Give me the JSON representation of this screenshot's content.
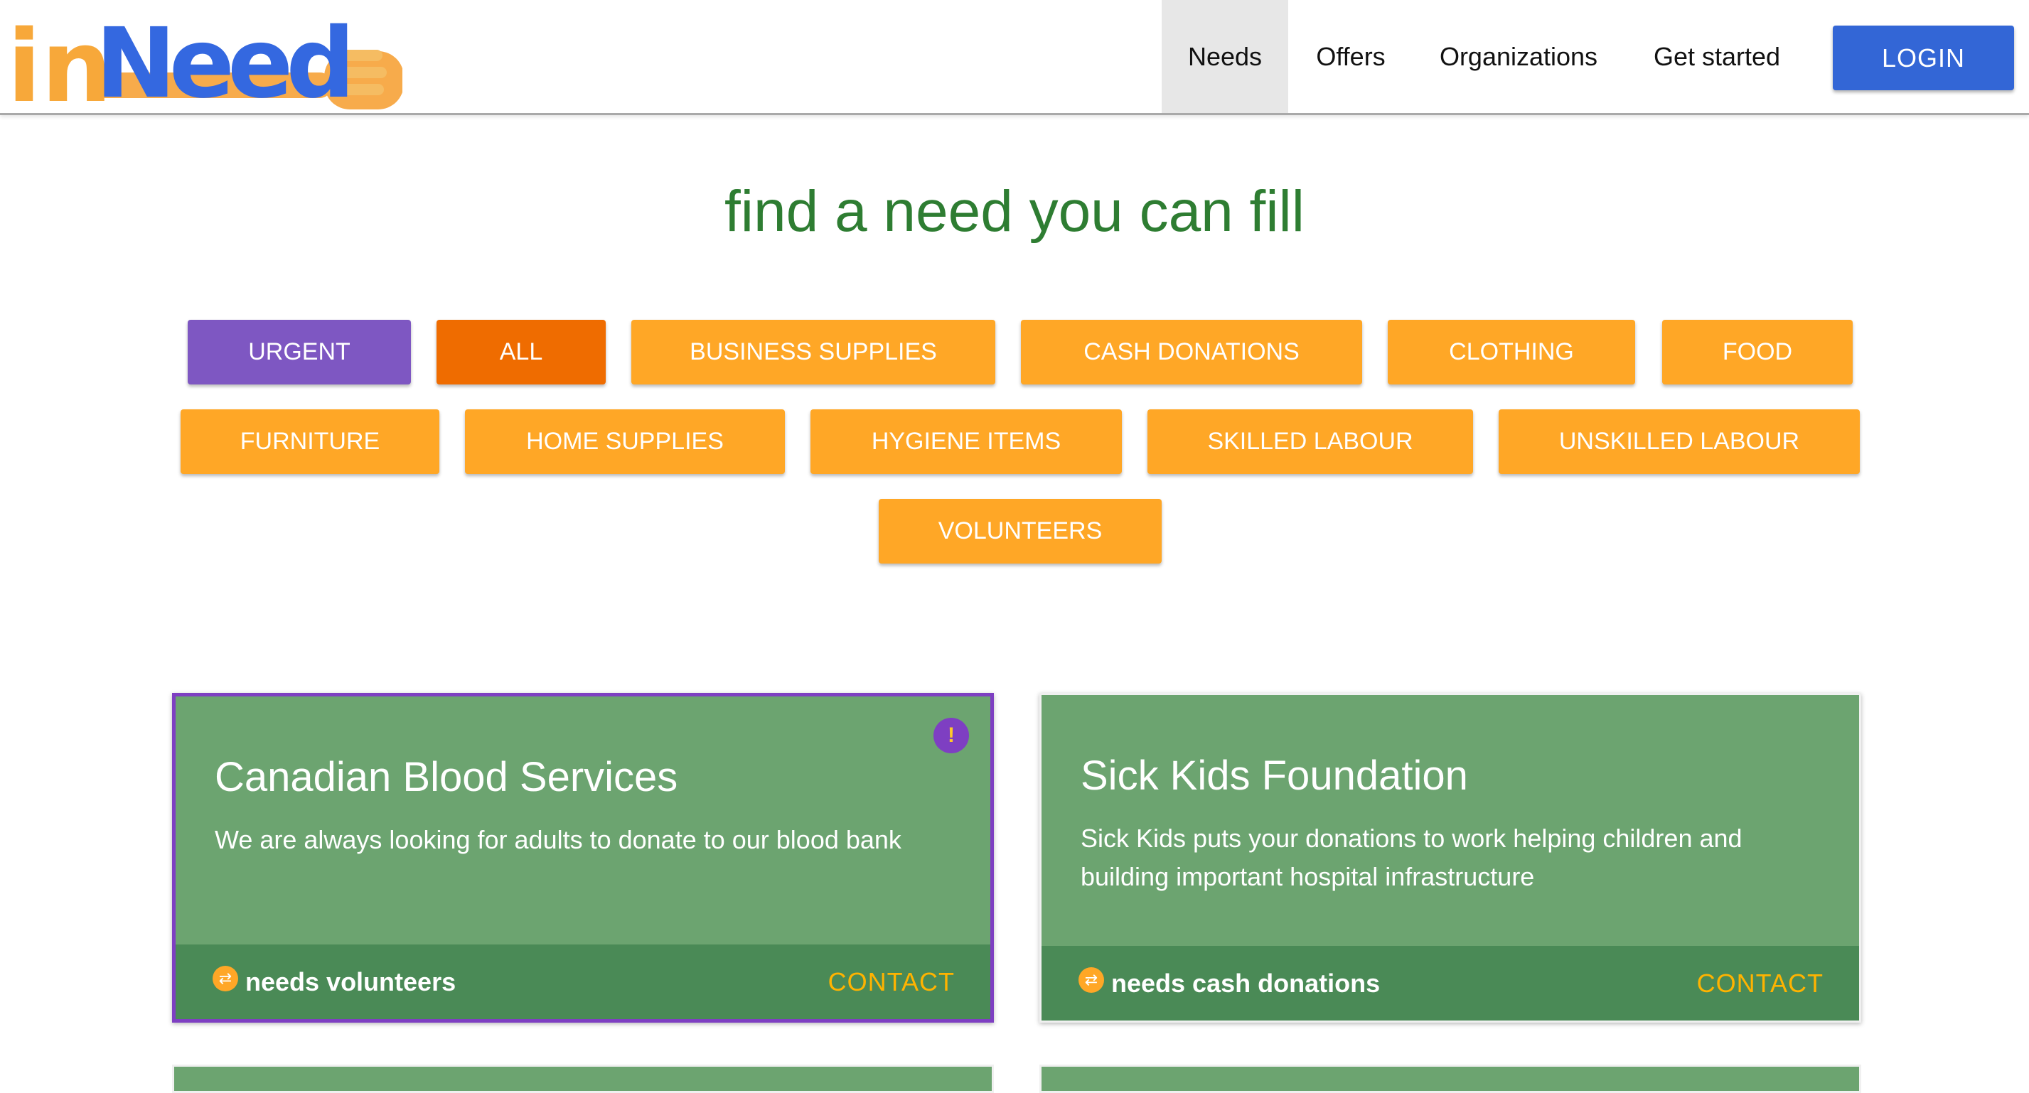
{
  "brand": {
    "logo_text_in": "in",
    "logo_text_need": "Need"
  },
  "nav": {
    "items": [
      {
        "label": "Needs"
      },
      {
        "label": "Offers"
      },
      {
        "label": "Organizations"
      },
      {
        "label": "Get started"
      }
    ],
    "login_label": "LOGIN"
  },
  "page": {
    "title": "find a need you can fill"
  },
  "filters": [
    {
      "label": "URGENT"
    },
    {
      "label": "ALL"
    },
    {
      "label": "BUSINESS SUPPLIES"
    },
    {
      "label": "CASH DONATIONS"
    },
    {
      "label": "CLOTHING"
    },
    {
      "label": "FOOD"
    },
    {
      "label": "FURNITURE"
    },
    {
      "label": "HOME SUPPLIES"
    },
    {
      "label": "HYGIENE ITEMS"
    },
    {
      "label": "SKILLED LABOUR"
    },
    {
      "label": "UNSKILLED LABOUR"
    },
    {
      "label": "VOLUNTEERS"
    }
  ],
  "cards": [
    {
      "title": "Canadian Blood Services",
      "description": "We are always looking for adults to donate to our blood bank",
      "need": "needs volunteers",
      "contact": "CONTACT",
      "urgent_mark": "!"
    },
    {
      "title": "Sick Kids Foundation",
      "description": "Sick Kids puts your donations to work helping children and building important hospital infrastructure",
      "need": "needs cash donations",
      "contact": "CONTACT"
    }
  ],
  "colors": {
    "accent_green": "#2e7d32",
    "card_green": "#6ca470",
    "footer_green": "#4a8a56",
    "chip_orange": "#ffa726",
    "chip_all": "#ef6c00",
    "chip_urgent": "#7e57c2",
    "login_blue": "#3366d6"
  }
}
